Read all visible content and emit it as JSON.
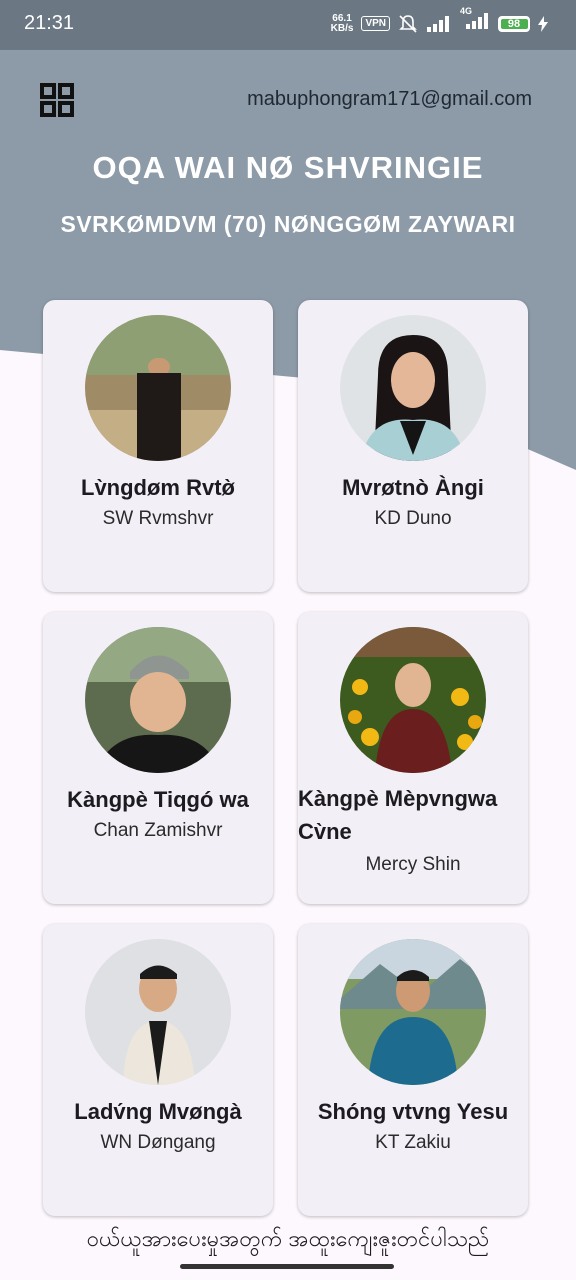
{
  "status_bar": {
    "time": "21:31",
    "net_speed_value": "66.1",
    "net_speed_unit": "KB/s",
    "vpn": "VPN",
    "network": "4G",
    "battery": "98"
  },
  "header": {
    "email": "mabuphongram171@gmail.com",
    "title": "OQA WAI NØ SHVRINGIE",
    "subtitle": "SVRKØMDVM (70) NØNGGØM ZAYWARI"
  },
  "members": [
    {
      "name": "Lv̀ngdøm Rvtø̀",
      "role": "SW Rvmshvr"
    },
    {
      "name": "Mvrøtnò Àngi",
      "role": "KD Duno"
    },
    {
      "name": "Kàngpè Tiqgó wa",
      "role": "Chan Zamishvr"
    },
    {
      "name": "Kàngpè Mèpvngwa Cv̀ne",
      "role": "Mercy Shin"
    },
    {
      "name": "Ladv́ng Mvøngà",
      "role": "WN Døngang"
    },
    {
      "name": "Shóng vtvng Yesu",
      "role": "KT Zakiu"
    }
  ],
  "footer": {
    "text": "ဝယ်ယူအားပေးမှုအတွက် အထူးကျေးဇူးတင်ပါသည်"
  },
  "colors": {
    "header_bg": "#8d9aa7",
    "card_bg": "#f3eff7",
    "page_bg": "#fdf8fd"
  }
}
